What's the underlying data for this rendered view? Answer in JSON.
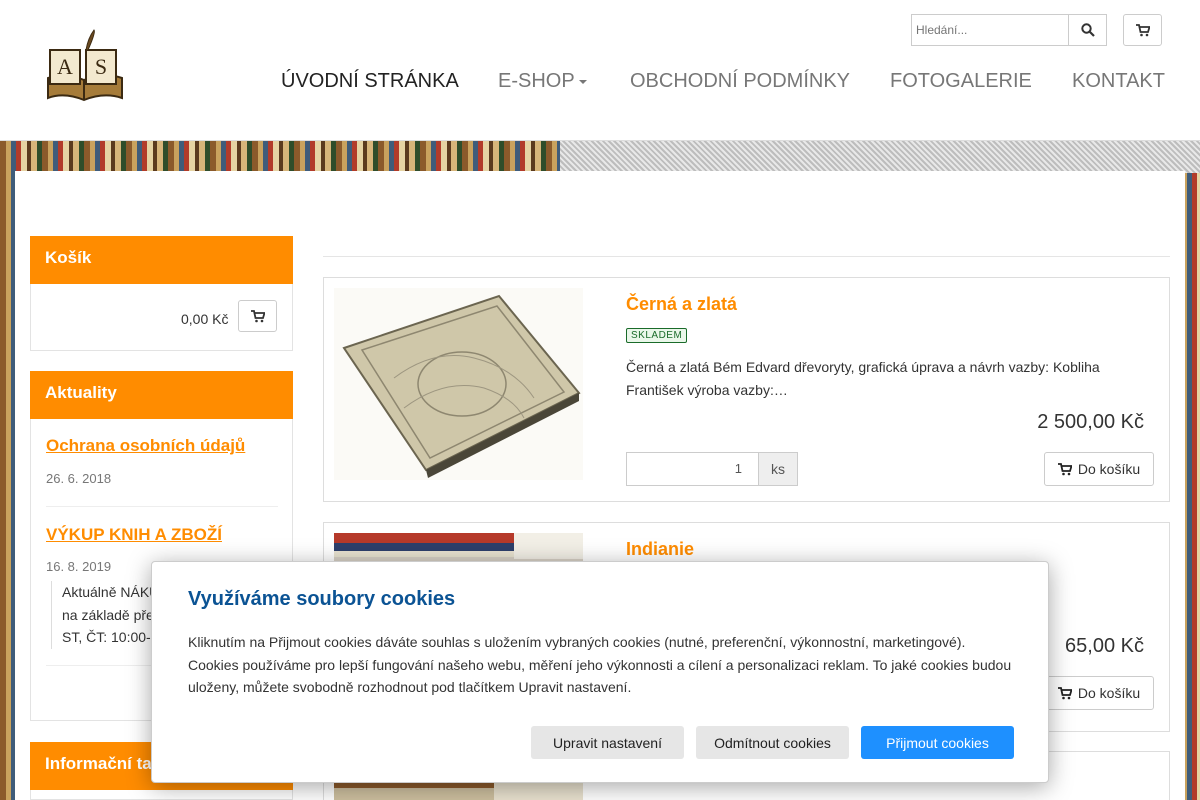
{
  "header": {
    "logo_text": "AS",
    "search_placeholder": "Hledání...",
    "nav": [
      {
        "label": "ÚVODNÍ STRÁNKA"
      },
      {
        "label": "E-SHOP"
      },
      {
        "label": "OBCHODNÍ PODMÍNKY"
      },
      {
        "label": "FOTOGALERIE"
      },
      {
        "label": "KONTAKT"
      }
    ]
  },
  "sidebar": {
    "cart": {
      "title": "Košík",
      "total": "0,00 Kč"
    },
    "news": {
      "title": "Aktuality",
      "items": [
        {
          "title": "Ochrana osobních údajů",
          "date": "26. 6. 2018"
        },
        {
          "title": "VÝKUP KNIH A ZBOŽÍ",
          "date": "16. 8. 2019",
          "lines": [
            "Aktuálně NÁKUP",
            "na základě pře",
            "ST, ČT: 10:00-"
          ]
        }
      ]
    },
    "info": {
      "title": "Informační ta"
    }
  },
  "products": [
    {
      "title": "Černá a zlatá",
      "badge": "SKLADEM",
      "desc": "Černá a zlatá Bém Edvard dřevoryty, grafická úprava a návrh vazby: Kobliha František výroba vazby:…",
      "price": "2 500,00 Kč",
      "qty": "1",
      "unit": "ks",
      "add_label": "Do košíku"
    },
    {
      "title": "Indianie",
      "price": "65,00 Kč",
      "add_label": "Do košíku"
    }
  ],
  "cookie": {
    "title": "Využíváme soubory cookies",
    "text": "Kliknutím na Přijmout cookies dáváte souhlas s uložením vybraných cookies (nutné, preferenční, výkonnostní, marketingové). Cookies používáme pro lepší fungování našeho webu, měření jeho výkonnosti a cílení a personalizaci reklam. To jaké cookies budou uloženy, můžete svobodně rozhodnout pod tlačítkem Upravit nastavení.",
    "btn_settings": "Upravit nastavení",
    "btn_reject": "Odmítnout cookies",
    "btn_accept": "Přijmout cookies"
  },
  "colors": {
    "accent": "#ff8c00",
    "cookie_title": "#0b5394",
    "accept_button": "#1e90ff"
  },
  "icons": [
    "logo-book-quill",
    "search-icon",
    "cart-icon"
  ]
}
